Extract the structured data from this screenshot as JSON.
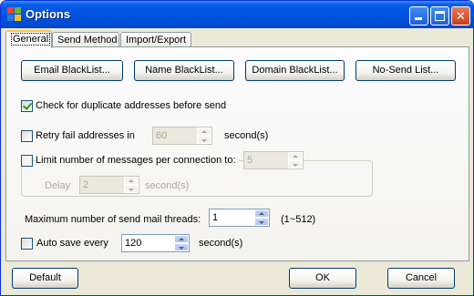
{
  "window": {
    "title": "Options"
  },
  "tabs": [
    {
      "label": "General",
      "active": true
    },
    {
      "label": "Send Method",
      "active": false
    },
    {
      "label": "Import/Export",
      "active": false
    }
  ],
  "blacklist_buttons": {
    "email": "Email BlackList...",
    "name": "Name BlackList...",
    "domain": "Domain BlackList...",
    "no_send": "No-Send List..."
  },
  "options": {
    "check_duplicates": {
      "label": "Check for duplicate addresses before send",
      "checked": true
    },
    "retry_fail": {
      "label": "Retry fail addresses in",
      "checked": false,
      "value": "60",
      "unit": "second(s)"
    },
    "limit_messages": {
      "label": "Limit number of messages per connection to:",
      "checked": false,
      "value": "5"
    },
    "delay": {
      "label": "Delay",
      "value": "2",
      "unit": "second(s)"
    },
    "max_threads": {
      "label": "Maximum number of send mail threads:",
      "value": "1",
      "range": "(1~512)"
    },
    "auto_save": {
      "label": "Auto save every",
      "checked": false,
      "value": "120",
      "unit": "second(s)"
    }
  },
  "footer": {
    "default_label": "Default",
    "ok_label": "OK",
    "cancel_label": "Cancel"
  },
  "colors": {
    "titlebar": "#0054e3",
    "face": "#ece9d8",
    "check_mark": "#21a121"
  }
}
